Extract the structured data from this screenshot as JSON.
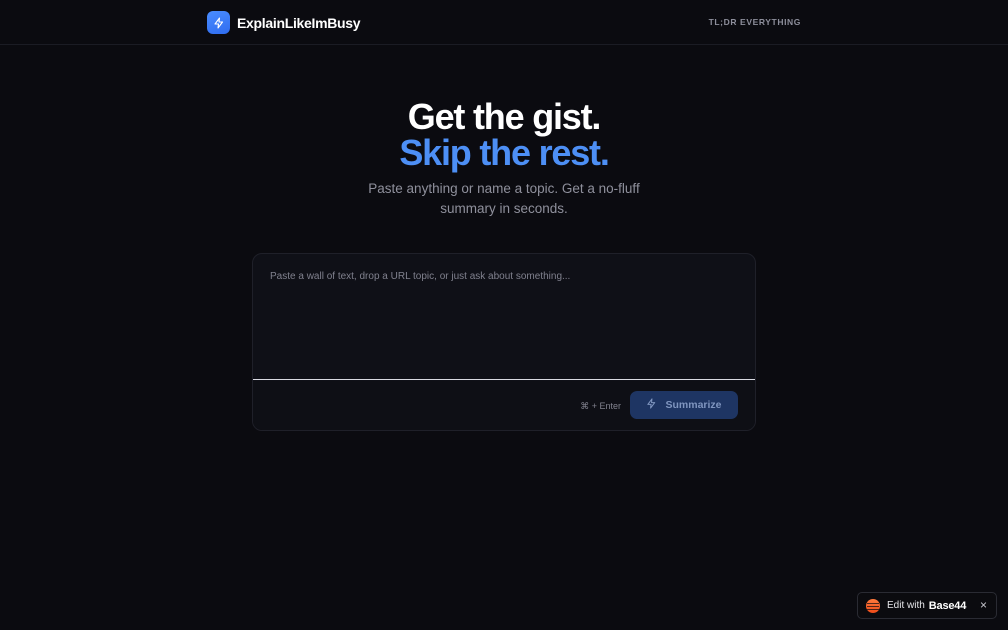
{
  "header": {
    "brand_name": "ExplainLikeImBusy",
    "tagline": "TL;DR EVERYTHING"
  },
  "hero": {
    "line1": "Get the gist.",
    "line2": "Skip the rest.",
    "subtitle": "Paste anything or name a topic. Get a no-fluff summary in seconds."
  },
  "input": {
    "value": "",
    "placeholder": "Paste a wall of text, drop a URL topic, or just ask about something...",
    "shortcut": "⌘ + Enter",
    "submit_label": "Summarize"
  },
  "badge": {
    "edit_label": "Edit with",
    "brand": "Base44",
    "close": "×"
  },
  "colors": {
    "background": "#0b0b10",
    "accent": "#4d8ff5",
    "button": "#1e3563",
    "base44": "#ee4b19"
  },
  "icons": {
    "brand": "lightning-bolt-icon",
    "submit": "lightning-bolt-icon",
    "badge": "base44-logo-icon",
    "close": "close-icon"
  }
}
